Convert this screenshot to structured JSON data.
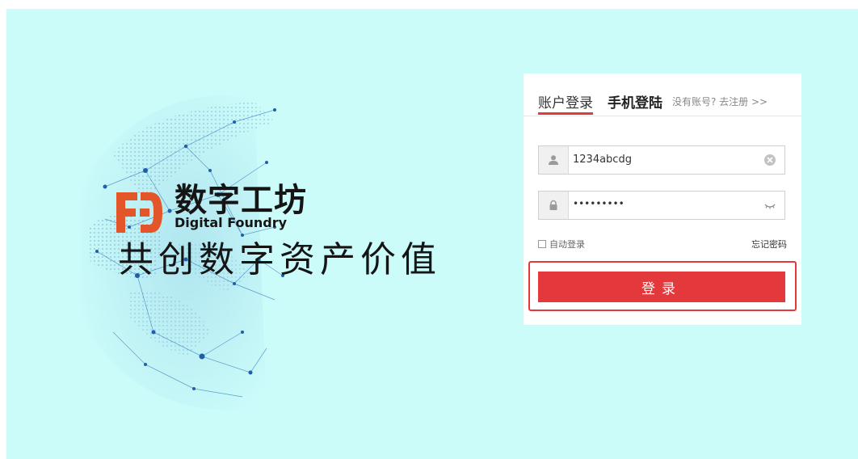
{
  "brand": {
    "name_cn": "数字工坊",
    "name_en": "Digital Foundry",
    "slogan": "共创数字资产价值",
    "color": "#e2562a"
  },
  "login": {
    "tab_account": "账户登录",
    "tab_phone": "手机登陆",
    "register_link": "没有账号? 去注册 >>",
    "username_value": "1234abcdg",
    "password_value": "•••••••••",
    "remember_label": "自动登录",
    "forgot_label": "忘记密码",
    "submit_label": "登录",
    "accent_color": "#e4393c"
  },
  "icons": {
    "username": "user-icon",
    "password": "lock-icon",
    "clear": "clear-icon",
    "reveal": "eye-closed-icon"
  }
}
